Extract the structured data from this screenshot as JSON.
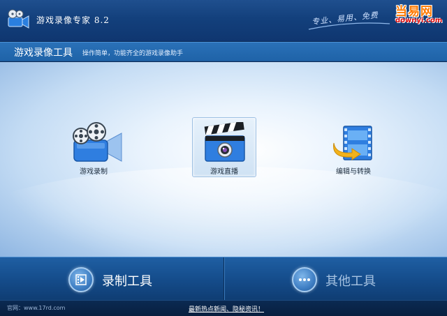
{
  "app": {
    "title": "游戏录像专家 8.2",
    "slogan": "专业、易用、免费",
    "watermark_top": "当易网",
    "watermark_bottom": "downyi.com"
  },
  "header": {
    "title": "游戏录像工具",
    "description": "操作简单，功能齐全的游戏录像助手"
  },
  "tools": [
    {
      "label": "游戏录制",
      "icon": "film-camera-icon"
    },
    {
      "label": "游戏直播",
      "icon": "clapperboard-camera-icon",
      "selected": true
    },
    {
      "label": "编辑与转换",
      "icon": "film-convert-icon"
    }
  ],
  "bottom_tabs": {
    "record": {
      "label": "录制工具",
      "icon": "film-strip-icon"
    },
    "other": {
      "label": "其他工具",
      "icon": "more-dots-icon"
    }
  },
  "footer": {
    "site": "官网：www.17rd.com",
    "news_link": "最新热点新闻、隐秘资讯！"
  },
  "colors": {
    "accent": "#1f63a8",
    "title_bar": "#13407c",
    "active_tab_text": "#ffffff",
    "inactive_tab_text": "#a7c3e2"
  }
}
